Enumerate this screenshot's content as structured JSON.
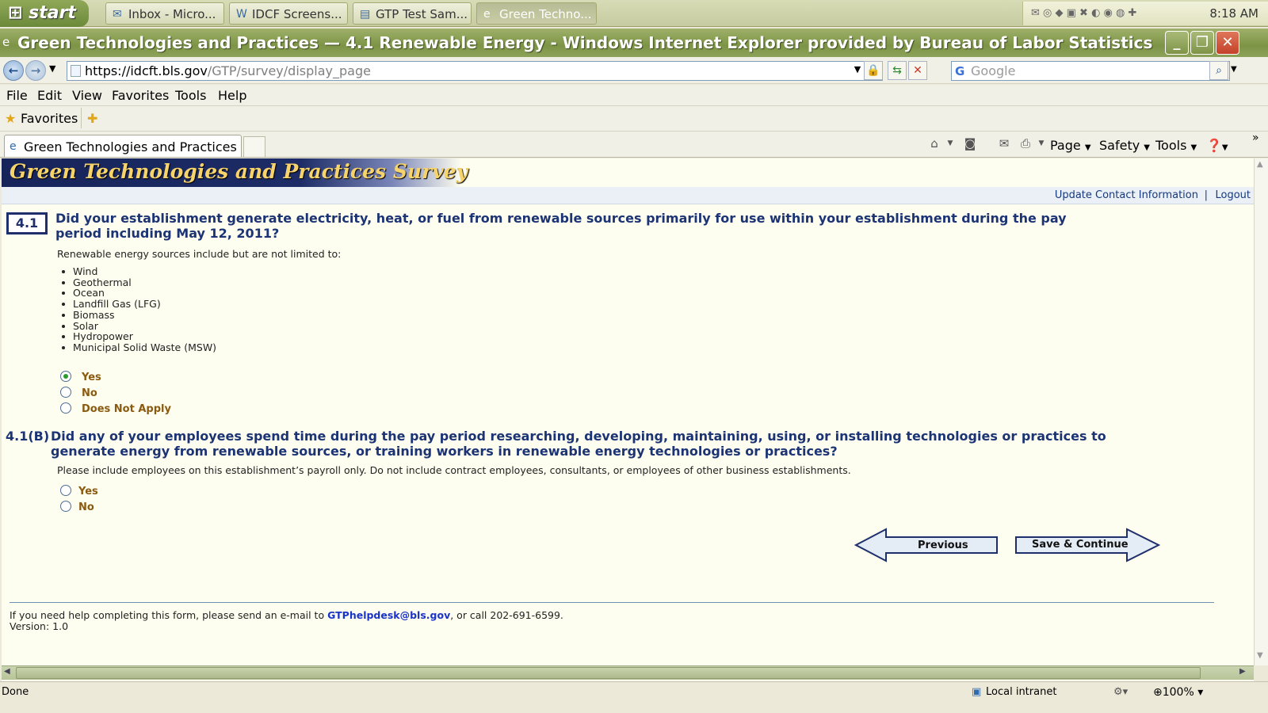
{
  "taskbar": {
    "start_label": "start",
    "tasks": [
      {
        "label": "Inbox - Micro..."
      },
      {
        "label": "IDCF Screens..."
      },
      {
        "label": "GTP Test Sam..."
      },
      {
        "label": "Green Techno..."
      }
    ],
    "clock": "8:18 AM"
  },
  "window": {
    "title": "Green Technologies and Practices — 4.1 Renewable Energy - Windows Internet Explorer provided by Bureau of Labor Statistics"
  },
  "address": {
    "host": "https://idcft.bls.gov",
    "path": "/GTP/survey/display_page",
    "search_placeholder": "Google"
  },
  "menu": [
    "File",
    "Edit",
    "View",
    "Favorites",
    "Tools",
    "Help"
  ],
  "favorites_label": "Favorites",
  "tab": {
    "label": "Green Technologies and Practices ..."
  },
  "commands": {
    "page": "Page",
    "safety": "Safety",
    "tools": "Tools"
  },
  "page": {
    "banner_title": "Green Technologies and Practices Survey",
    "update_contact": "Update Contact Information",
    "separator": "|",
    "logout": "Logout",
    "q1": {
      "number": "4.1",
      "text": "Did your establishment generate electricity, heat, or fuel from renewable sources primarily for use within your establishment during the pay period including May 12, 2011?",
      "note": "Renewable energy sources include but are not limited to:",
      "sources": [
        "Wind",
        "Geothermal",
        "Ocean",
        "Landfill Gas (LFG)",
        "Biomass",
        "Solar",
        "Hydropower",
        "Municipal Solid Waste (MSW)"
      ],
      "options": [
        "Yes",
        "No",
        "Does Not Apply"
      ],
      "selected": "Yes"
    },
    "q2": {
      "number": "4.1(B)",
      "text": "Did any of your employees spend time during the pay period researching, developing, maintaining, using, or installing technologies or practices to generate energy from renewable sources, or training workers in renewable energy technologies or practices?",
      "note": "Please include employees on this establishment’s payroll only. Do not include contract employees, consultants, or employees of other business establishments.",
      "options": [
        "Yes",
        "No"
      ]
    },
    "buttons": {
      "previous": "Previous",
      "save_continue": "Save & Continue"
    },
    "footer": {
      "help_prefix": "If you need help completing this form, please send an e-mail to ",
      "email": "GTPhelpdesk@bls.gov",
      "help_suffix": ", or call 202-691-6599.",
      "version": "Version: 1.0"
    }
  },
  "status": {
    "left": "Done",
    "zone": "Local intranet",
    "zoom": "100%"
  },
  "colors": {
    "question_blue": "#1c3474",
    "option_brown": "#8a5a10",
    "banner_navy": "#16245a",
    "banner_gold": "#f6d36b",
    "content_bg": "#fefef0"
  }
}
